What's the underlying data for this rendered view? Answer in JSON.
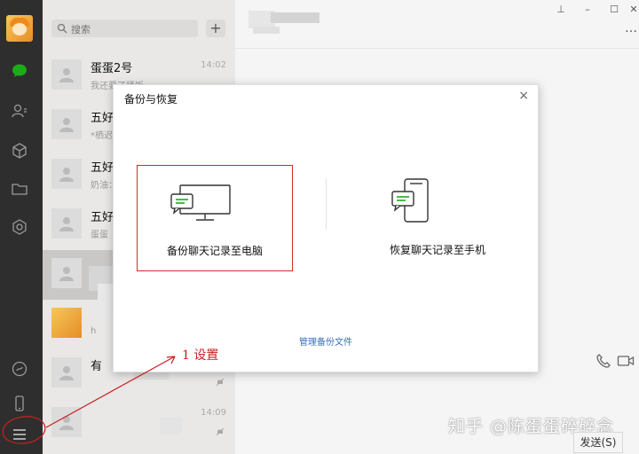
{
  "search": {
    "placeholder": "搜索",
    "add_label": "+"
  },
  "chats": [
    {
      "name": "蛋蛋2号",
      "msg": "我还要了桶饭",
      "time": "14:02"
    },
    {
      "name": "五好",
      "msg": "*栖迟",
      "time": ""
    },
    {
      "name": "五好",
      "msg": "奶油：",
      "time": ""
    },
    {
      "name": "五好",
      "msg": "蛋蛋",
      "time": ""
    },
    {
      "name": "",
      "msg": "",
      "time": ""
    },
    {
      "name": "",
      "msg": "h",
      "time": ""
    },
    {
      "name": "有",
      "msg": "",
      "time": ""
    },
    {
      "name": "",
      "msg": "",
      "time": "14:09"
    }
  ],
  "window": {
    "pin": "⊥",
    "minimize": "–",
    "maximize": "☐",
    "close": "✕",
    "more": "…"
  },
  "modal": {
    "title": "备份与恢复",
    "close": "×",
    "backup_label": "备份聊天记录至电脑",
    "restore_label": "恢复聊天记录至手机",
    "manage_label": "管理备份文件"
  },
  "annotation": {
    "text": "1 设置"
  },
  "watermark": "知乎 @陈蛋蛋碎碎念",
  "send_label": "发送(S)",
  "colors": {
    "sidebar": "#2e2e2e",
    "accent_green": "#1aad19",
    "annotation_red": "#c81f1f",
    "link_blue": "#376fb5"
  }
}
